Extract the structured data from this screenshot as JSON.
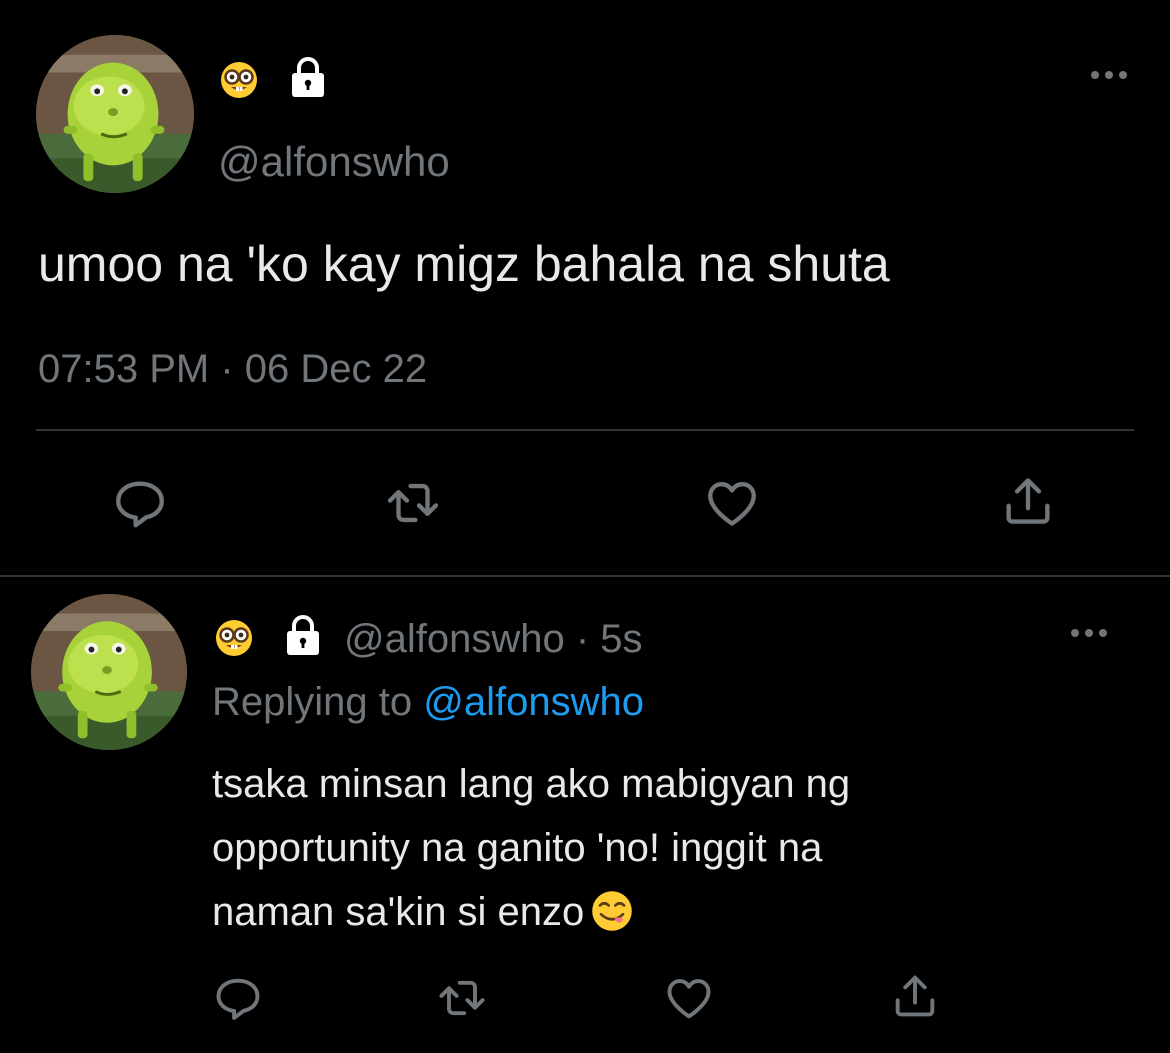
{
  "main_tweet": {
    "avatar_icon": "mike-wazowski-sulley-face-avatar",
    "name_emoji_icon": "nerd-face-emoji-icon",
    "protected_icon": "lock-icon",
    "handle": "@alfonswho",
    "more_icon": "more-dots-icon",
    "text": "umoo na 'ko kay migz bahala na shuta",
    "timestamp": "07:53 PM · 06 Dec 22",
    "actions": [
      "reply-icon",
      "retweet-icon",
      "like-icon",
      "share-icon"
    ]
  },
  "reply_tweet": {
    "avatar_icon": "mike-wazowski-sulley-face-avatar",
    "name_emoji_icon": "nerd-face-emoji-icon",
    "protected_icon": "lock-icon",
    "handle_time": "@alfonswho · 5s",
    "more_icon": "more-dots-icon",
    "replying_label": "Replying to",
    "replying_mention": "@alfonswho",
    "text_lines": [
      "tsaka minsan lang ako mabigyan ng",
      "opportunity na ganito 'no! inggit na",
      "naman sa'kin si enzo"
    ],
    "text_emoji_icon": "face-savoring-food-emoji-icon",
    "actions": [
      "reply-icon",
      "retweet-icon",
      "like-icon",
      "share-icon"
    ]
  },
  "colors": {
    "background": "#000000",
    "text_primary": "#e7e9ea",
    "text_secondary": "#71767b",
    "link": "#1d9bf0",
    "divider": "#2f3336"
  }
}
